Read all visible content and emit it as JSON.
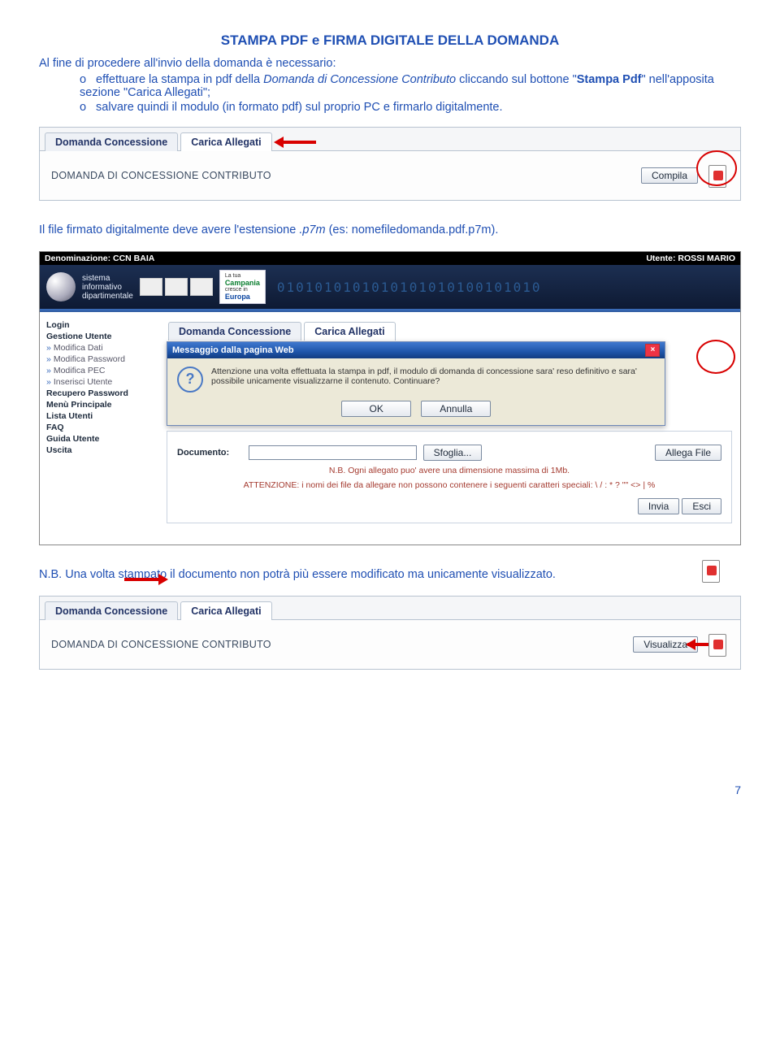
{
  "title": "STAMPA PDF e FIRMA DIGITALE DELLA DOMANDA",
  "intro": "Al fine di procedere all'invio della domanda è necessario:",
  "bullets": [
    {
      "bul": "o",
      "pre": "effettuare la stampa in pdf della ",
      "ital": "Domanda di Concessione Contributo",
      "mid": " cliccando sul bottone \"",
      "bold": "Stampa Pdf",
      "post": "\" nell'apposita sezione \"Carica Allegati\";"
    },
    {
      "bul": "o",
      "pre": "salvare quindi il modulo (in formato pdf) sul proprio PC e firmarlo digitalmente.",
      "ital": "",
      "mid": "",
      "bold": "",
      "post": ""
    }
  ],
  "panel1": {
    "tab1": "Domanda Concessione",
    "tab2": "Carica Allegati",
    "label": "DOMANDA DI CONCESSIONE CONTRIBUTO",
    "btn": "Compila"
  },
  "para2_pre": "Il file firmato digitalmente deve avere l'estensione ",
  "para2_ital": ".p7m",
  "para2_post": " (es: nomefiledomanda.pdf.p7m).",
  "sys": {
    "denom": "Denominazione: CCN BAIA",
    "utente": "Utente: ROSSI MARIO",
    "sistema1": "sistema",
    "sistema2": "informativo",
    "sistema3": "dipartimentale",
    "campania1": "La tua",
    "campania2": "Campania",
    "campania3": "cresce in",
    "campania4": "Europa",
    "bits": "0101010101010101010100101010",
    "side": {
      "login": "Login",
      "gestione": "Gestione Utente",
      "s1": "Modifica Dati",
      "s2": "Modifica Password",
      "s3": "Modifica PEC",
      "s4": "Inserisci Utente",
      "rec": "Recupero Password",
      "menu": "Menù Principale",
      "lista": "Lista Utenti",
      "faq": "FAQ",
      "guida": "Guida Utente",
      "uscita": "Uscita"
    },
    "tab1": "Domanda Concessione",
    "tab2": "Carica Allegati",
    "dlg_title": "Messaggio dalla pagina Web",
    "dlg_msg": "Attenzione una volta effettuata la stampa in pdf, il modulo di domanda di concessione sara' reso definitivo e sara' possibile unicamente visualizzarne il contenuto. Continuare?",
    "ok": "OK",
    "annulla": "Annulla",
    "doc_lab": "Documento:",
    "sfoglia": "Sfoglia...",
    "allega": "Allega File",
    "note": "N.B. Ogni allegato puo' avere una dimensione massima di 1Mb.",
    "warn": "ATTENZIONE: i nomi dei file da allegare non possono contenere i seguenti caratteri speciali: \\ / : * ? \"\" <> | %",
    "invia": "Invia",
    "esci": "Esci"
  },
  "nb": "N.B. Una volta stampato il documento non potrà più essere modificato ma unicamente visualizzato.",
  "panel2": {
    "tab1": "Domanda Concessione",
    "tab2": "Carica Allegati",
    "label": "DOMANDA DI CONCESSIONE CONTRIBUTO",
    "btn": "Visualizza"
  },
  "page": "7"
}
